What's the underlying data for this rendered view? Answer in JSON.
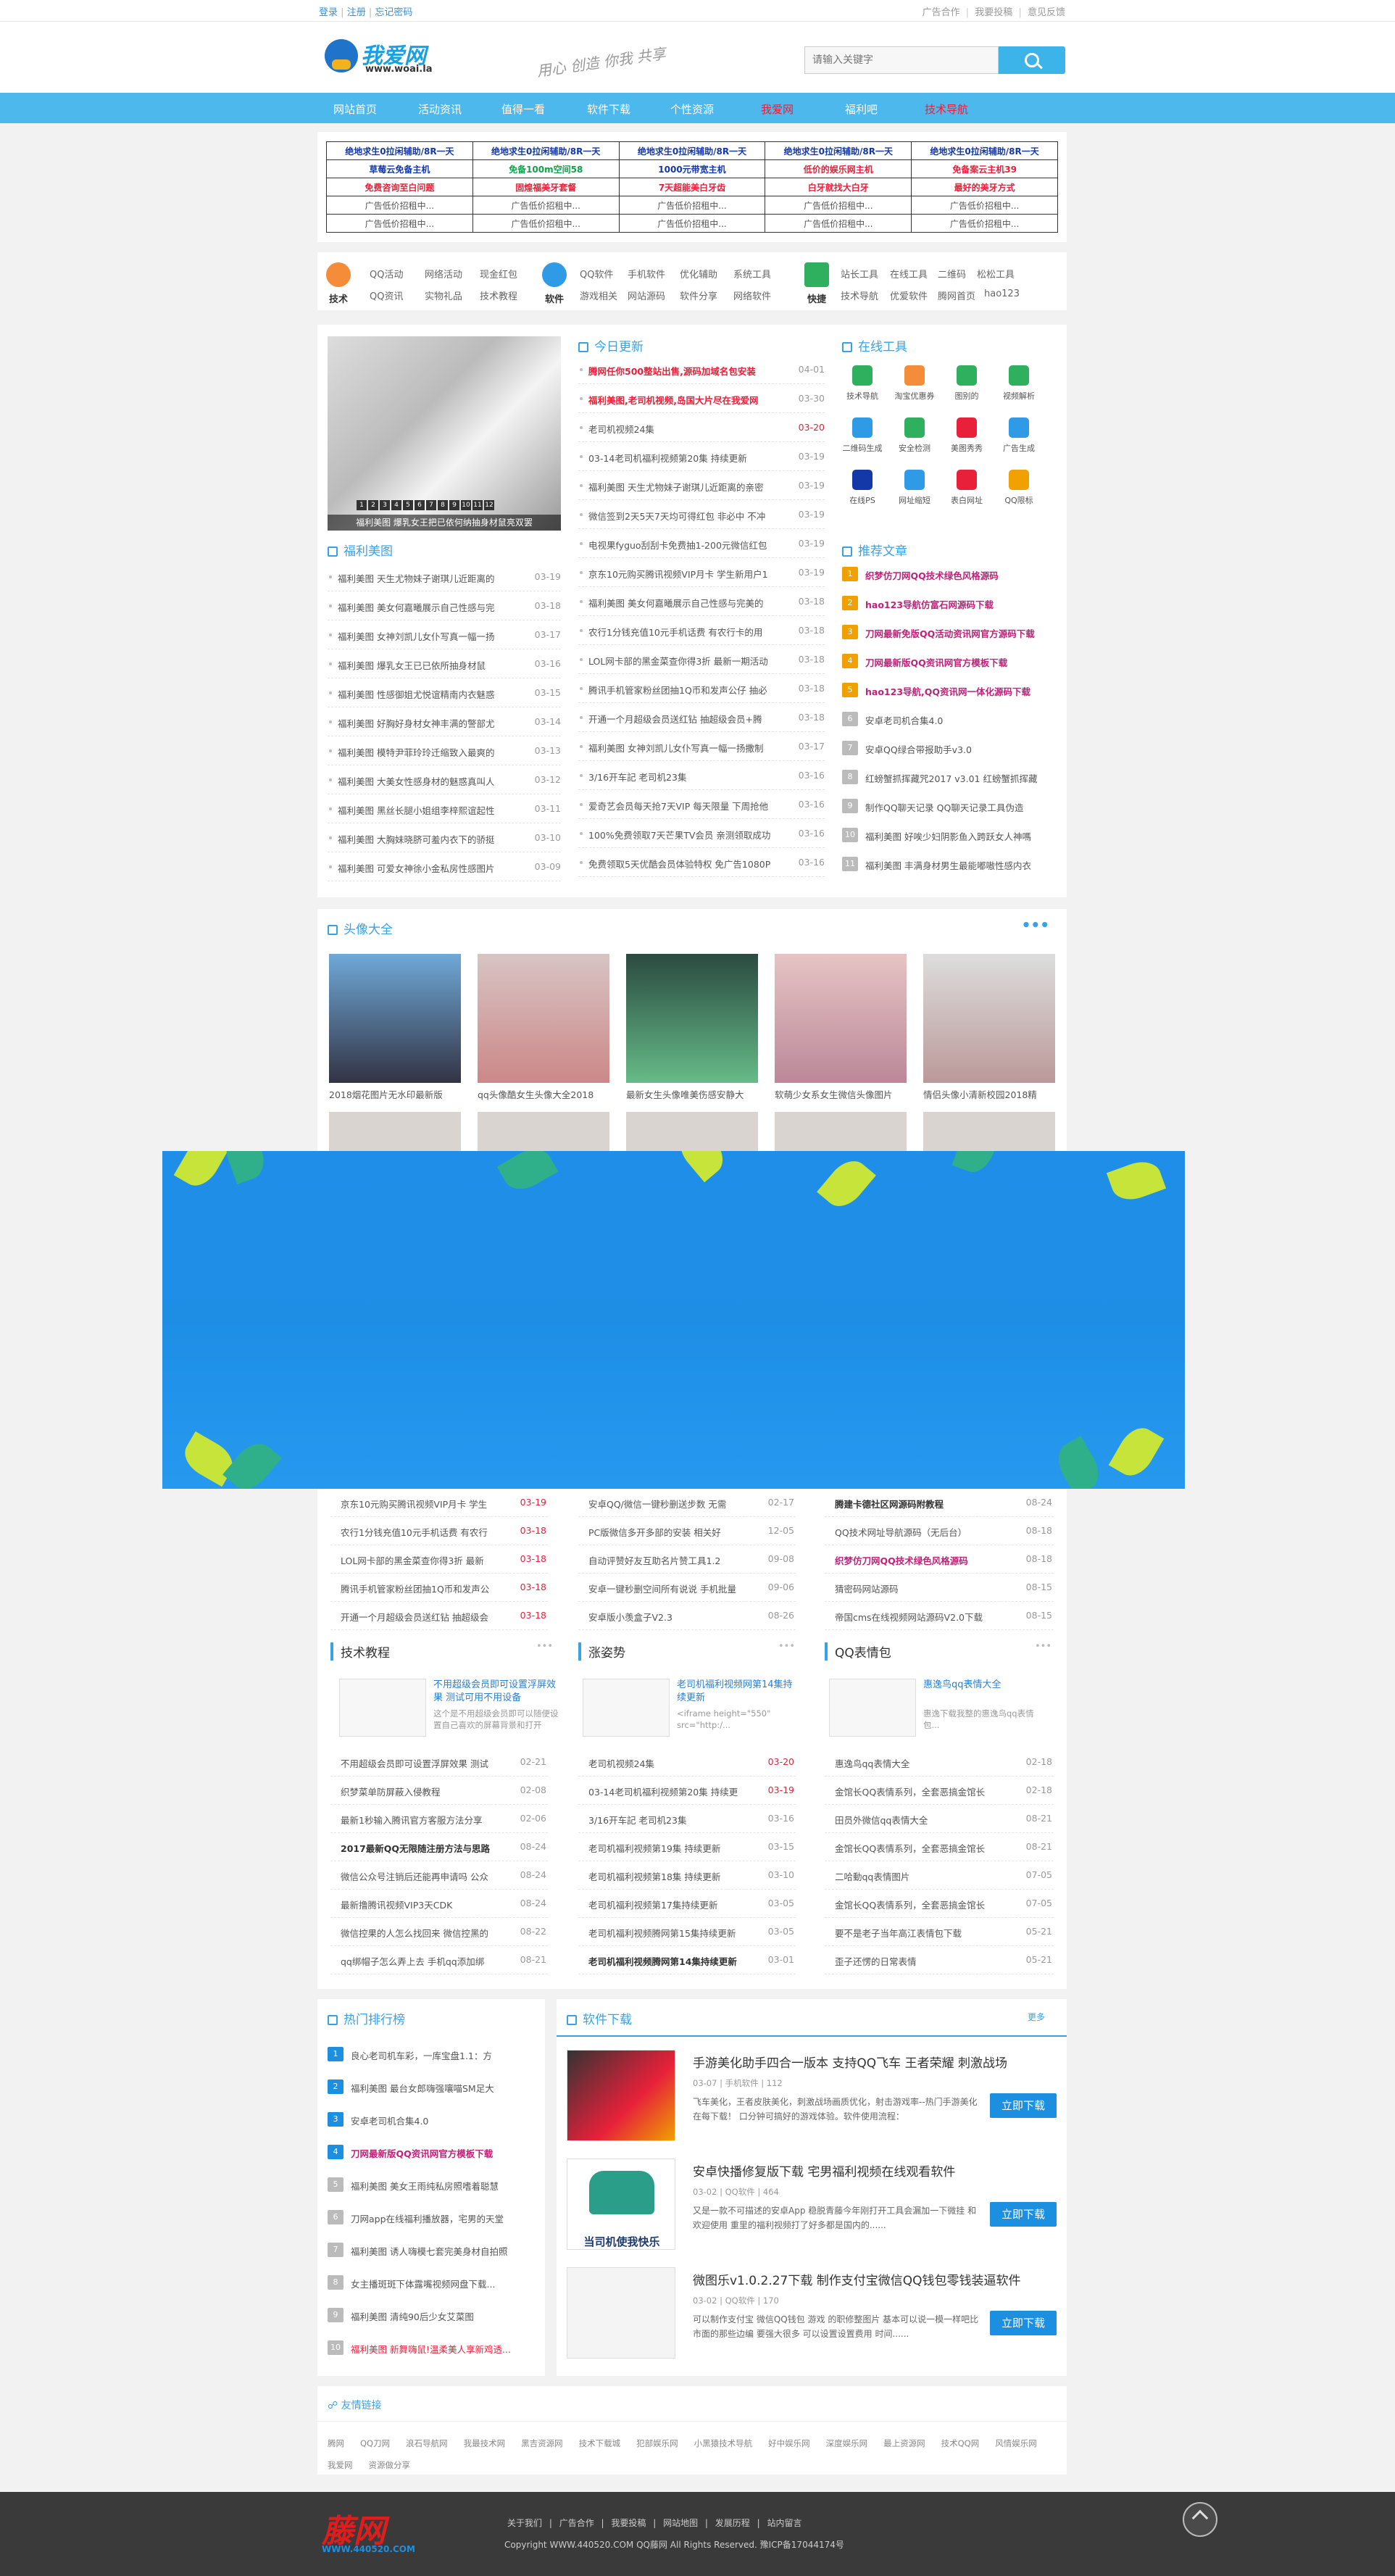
{
  "topbar": {
    "login": "登录",
    "sep1": "|",
    "register": "注册",
    "sep2": "|",
    "forgot": "忘记密码",
    "ad": "广告合作",
    "contribute": "我要投稿",
    "feedback": "意见反馈"
  },
  "header": {
    "logo_cn": "我爱网",
    "logo_url": "www.woai.la",
    "slogan": "用心 创造 你我 共享",
    "search_placeholder": "请输入关键字"
  },
  "nav": [
    "网站首页",
    "活动资讯",
    "值得一看",
    "软件下载",
    "个性资源",
    "我爱网",
    "福利吧",
    "技术导航"
  ],
  "ads": [
    [
      "绝地求生0拉闲辅助/8R一天",
      "绝地求生0拉闲辅助/8R一天",
      "绝地求生0拉闲辅助/8R一天",
      "绝地求生0拉闲辅助/8R一天",
      "绝地求生0拉闲辅助/8R一天"
    ],
    [
      "草莓云免备主机",
      "免备100m空间58",
      "1000元带宽主机",
      "低价的娱乐网主机",
      "免备案云主机39"
    ],
    [
      "免费咨询至白问题",
      "固煌福美牙套督",
      "7天超能美白牙齿",
      "白牙就找大白牙",
      "最好的美牙方式"
    ],
    [
      "广告低价招租中...",
      "广告低价招租中...",
      "广告低价招租中...",
      "广告低价招租中...",
      "广告低价招租中..."
    ],
    [
      "广告低价招租中...",
      "广告低价招租中...",
      "广告低价招租中...",
      "广告低价招租中...",
      "广告低价招租中..."
    ]
  ],
  "categories": [
    {
      "title": "技术",
      "links": [
        "QQ活动",
        "网络活动",
        "现金红包",
        "QQ资讯",
        "实物礼品",
        "技术教程"
      ]
    },
    {
      "title": "软件",
      "links": [
        "QQ软件",
        "手机软件",
        "优化辅助",
        "系统工具",
        "游戏相关",
        "网站源码",
        "软件分享",
        "网络软件"
      ]
    },
    {
      "title": "快捷",
      "links": [
        "站长工具",
        "在线工具",
        "二维码",
        "松松工具",
        "技术导航",
        "优爱软件",
        "腾网首页",
        "hao123"
      ]
    }
  ],
  "slider": {
    "caption": "福利美图 爆乳女王把已依何纳抽身材鼠亮双罢",
    "dots": [
      "1",
      "2",
      "3",
      "4",
      "5",
      "6",
      "7",
      "8",
      "9",
      "10",
      "11",
      "12"
    ]
  },
  "fuli": {
    "title": "福利美图",
    "rows": [
      {
        "t": "福利美图 天生尤物妹子谢琪儿近距离的",
        "d": "03-19"
      },
      {
        "t": "福利美图 美女何嘉曦展示自己性感与完",
        "d": "03-18"
      },
      {
        "t": "福利美图 女神刘凯儿女仆写真一幅一扬",
        "d": "03-17"
      },
      {
        "t": "福利美图 爆乳女王已已依所抽身材鼠",
        "d": "03-16"
      },
      {
        "t": "福利美图 性感御姐尤悦谊精南内衣魅惑",
        "d": "03-15"
      },
      {
        "t": "福利美图 好胸好身材女神丰满的警部尤",
        "d": "03-14"
      },
      {
        "t": "福利美图 模特尹菲玲玲迁缩致入最爽的",
        "d": "03-13"
      },
      {
        "t": "福利美图 大美女性感身材的魅惑真叫人",
        "d": "03-12"
      },
      {
        "t": "福利美图 黑丝长腿小姐组李梓熙谊起性",
        "d": "03-11"
      },
      {
        "t": "福利美图 大胸妹晓脐可羞内衣下的骄挺",
        "d": "03-10"
      },
      {
        "t": "福利美图 可爱女神徐小金私房性感图片",
        "d": "03-09"
      }
    ]
  },
  "today": {
    "title": "今日更新",
    "rows": [
      {
        "t": "腾网任你500整站出售,源码加域名包安装",
        "d": "04-01",
        "style": "hot"
      },
      {
        "t": "福利美图,老司机视频,岛国大片尽在我爱网",
        "d": "03-30",
        "style": "hot"
      },
      {
        "t": "老司机视频24集",
        "d": "03-20",
        "style": "",
        "red": true
      },
      {
        "t": "03-14老司机福利视频第20集 持续更新",
        "d": "03-19",
        "style": ""
      },
      {
        "t": "福利美图 天生尤物妹子谢琪儿近距离的亲密",
        "d": "03-19",
        "style": ""
      },
      {
        "t": "微信签到2天5天7天均可得红包 非必中 不冲",
        "d": "03-19",
        "style": ""
      },
      {
        "t": "电视果fyguo刮刮卡免费抽1-200元微信红包",
        "d": "03-19",
        "style": ""
      },
      {
        "t": "京东10元购买腾讯视频VIP月卡 学生新用户1",
        "d": "03-19",
        "style": ""
      },
      {
        "t": "福利美图 美女何嘉曦展示自己性感与完美的",
        "d": "03-18",
        "style": ""
      },
      {
        "t": "农行1分钱充值10元手机话费 有农行卡的用",
        "d": "03-18",
        "style": ""
      },
      {
        "t": "LOL网卡部的黑金菜查你得3折 最新一期活动",
        "d": "03-18",
        "style": ""
      },
      {
        "t": "腾讯手机管家粉丝团抽1Q币和发声公仔 抽必",
        "d": "03-18",
        "style": ""
      },
      {
        "t": "开通一个月超级会员送红钻 抽超级会员+腾",
        "d": "03-18",
        "style": ""
      },
      {
        "t": "福利美图 女神刘凯儿女仆写真一幅一扬撒制",
        "d": "03-17",
        "style": ""
      },
      {
        "t": "3/16开车記 老司机23集",
        "d": "03-16",
        "style": ""
      },
      {
        "t": "爱奇艺会员每天抢7天VIP 每天限量 下周抢他",
        "d": "03-16",
        "style": ""
      },
      {
        "t": "100%免费领取7天芒果TV会员 亲测领取成功",
        "d": "03-16",
        "style": ""
      },
      {
        "t": "免费领取5天优酷会员体验特权 免广告1080P",
        "d": "03-16",
        "style": ""
      }
    ]
  },
  "tools": {
    "title": "在线工具",
    "items": [
      "技术导航",
      "淘宝优惠券",
      "图别的",
      "视频解析",
      "二维码生成",
      "安全检测",
      "美图秀秀",
      "广告生成",
      "在线PS",
      "网址缩短",
      "表白网址",
      "QQ限标"
    ]
  },
  "recommend": {
    "title": "推荐文章",
    "rows": [
      {
        "t": "织梦仿刀网QQ技术绿色风格源码",
        "style": "pink"
      },
      {
        "t": "hao123导航仿富石网源码下载",
        "style": "pink"
      },
      {
        "t": "刀网最新免版QQ活动资讯网官方源码下载",
        "style": "pink"
      },
      {
        "t": "刀网最新版QQ资讯网官方模板下载",
        "style": "pink"
      },
      {
        "t": "hao123导航,QQ资讯网一体化源码下载",
        "style": "pink"
      },
      {
        "t": "安卓老司机合集4.0",
        "style": ""
      },
      {
        "t": "安卓QQ绿合带报助手v3.0",
        "style": ""
      },
      {
        "t": "红螃蟹抓挥藏咒2017 v3.01 红螃蟹抓挥藏",
        "style": ""
      },
      {
        "t": "制作QQ聊天记录 QQ聊天记录工具伪造",
        "style": ""
      },
      {
        "t": "福利美图 好唉少妇阴影鱼入跨跃女人神嗎",
        "style": ""
      },
      {
        "t": "福利美图 丰满身材男生最能嘟嗷性感内衣",
        "style": ""
      }
    ]
  },
  "avatars": {
    "title": "头像大全",
    "more": "•••",
    "items": [
      "2018烟花图片无水印最新版",
      "qq头像酷女生头像大全2018",
      "最新女生头像唯美伤感安静大",
      "软萌少女系女生微信头像图片",
      "情侣头像小清新校园2018精"
    ]
  },
  "lower_lists": {
    "col1": [
      {
        "t": "京东10元购买腾讯视频VIP月卡 学生",
        "d": "03-19",
        "red": true
      },
      {
        "t": "农行1分钱充值10元手机话费 有农行",
        "d": "03-18",
        "red": true
      },
      {
        "t": "LOL网卡部的黑金菜查你得3折 最新",
        "d": "03-18",
        "red": true
      },
      {
        "t": "腾讯手机管家粉丝团抽1Q币和发声公",
        "d": "03-18",
        "red": true
      },
      {
        "t": "开通一个月超级会员送红钻 抽超级会",
        "d": "03-18",
        "red": true
      }
    ],
    "col2": [
      {
        "t": "安卓QQ/微信一键秒删送步数 无需",
        "d": "02-17"
      },
      {
        "t": "PC版微信多开多部的安装 相关好",
        "d": "12-05"
      },
      {
        "t": "自动评赞好友互助名片赞工具1.2",
        "d": "09-08"
      },
      {
        "t": "安卓一键秒删空间所有说说 手机批量",
        "d": "09-06"
      },
      {
        "t": "安卓版小羡盒子V2.3",
        "d": "08-26"
      }
    ],
    "col3": [
      {
        "t": "腾建卡德社区网源码附教程",
        "d": "08-24",
        "style": "bold"
      },
      {
        "t": "QQ技术网址导航源码（无后台）",
        "d": "08-18"
      },
      {
        "t": "织梦仿刀网QQ技术绿色风格源码",
        "d": "08-18",
        "style": "pink"
      },
      {
        "t": "猜密码网站源码",
        "d": "08-15"
      },
      {
        "t": "帝国cms在线视频网站源码V2.0下载",
        "d": "08-15"
      }
    ]
  },
  "tech": {
    "title": "技术教程",
    "more": "•••",
    "feat_title": "不用超级会员即可设置浮屏效果 测试可用不用设备",
    "feat_desc": "这个是不用超级会员即可以随便设置自己喜欢的屏幕背景和打开",
    "rows": [
      {
        "t": "不用超级会员即可设置浮屏效果 测试",
        "d": "02-21"
      },
      {
        "t": "织梦菜单防屏蔽入侵教程",
        "d": "02-08"
      },
      {
        "t": "最新1秒输入腾讯官方客服方法分享",
        "d": "02-06"
      },
      {
        "t": "2017最新QQ无限随注册方法与思路",
        "d": "08-24",
        "style": "bold"
      },
      {
        "t": "微信公众号注销后还能再申请吗 公众",
        "d": "08-24"
      },
      {
        "t": "最新撸腾讯视频VIP3天CDK",
        "d": "08-24"
      },
      {
        "t": "微信控果的人怎么找回来 微信控黑的",
        "d": "08-22"
      },
      {
        "t": "qq绑帽子怎么弄上去 手机qq添加绑",
        "d": "08-21"
      }
    ]
  },
  "pose": {
    "title": "涨姿势",
    "more": "•••",
    "feat_title": "老司机福利视频网第14集持续更新",
    "feat_desc": "<iframe height=\"550\" src=\"http:/...",
    "rows": [
      {
        "t": "老司机视频24集",
        "d": "03-20",
        "red": true
      },
      {
        "t": "03-14老司机福利视频第20集 持续更",
        "d": "03-19",
        "red": true
      },
      {
        "t": "3/16开车記 老司机23集",
        "d": "03-16"
      },
      {
        "t": "老司机福利视频第19集 持续更新",
        "d": "03-15"
      },
      {
        "t": "老司机福利视频第18集 持续更新",
        "d": "03-10"
      },
      {
        "t": "老司机福利视频第17集持续更新",
        "d": "03-05"
      },
      {
        "t": "老司机福利视频腾网第15集持续更新",
        "d": "03-05"
      },
      {
        "t": "老司机福利视频腾网第14集持续更新",
        "d": "03-01",
        "style": "bold"
      }
    ]
  },
  "emoji": {
    "title": "QQ表情包",
    "more": "•••",
    "feat_title": "惠逸鸟qq表情大全",
    "feat_desc": "惠逸下载我整的惠逸鸟qq表情包...",
    "rows": [
      {
        "t": "惠逸鸟qq表情大全",
        "d": "02-18"
      },
      {
        "t": "金馆长QQ表情系列，全套恶搞金馆长",
        "d": "02-18"
      },
      {
        "t": "田员外微信qq表情大全",
        "d": "08-21"
      },
      {
        "t": "金馆长QQ表情系列，全套恶搞金馆长",
        "d": "08-21"
      },
      {
        "t": "二哈動qq表情图片",
        "d": "07-05"
      },
      {
        "t": "金馆长QQ表情系列，全套恶搞金馆长",
        "d": "07-05"
      },
      {
        "t": "要不是老子当年高江表情包下载",
        "d": "05-21"
      },
      {
        "t": "歪子还愣的日常表情",
        "d": "05-21"
      }
    ]
  },
  "hot": {
    "title": "热门排行榜",
    "rows": [
      {
        "n": "1",
        "t": "良心老司机车彩，一库宝盘1.1：方",
        "style": ""
      },
      {
        "n": "2",
        "t": "福利美图 最台女郎嗨强嚷喵SM足大",
        "style": ""
      },
      {
        "n": "3",
        "t": "安卓老司机合集4.0",
        "style": ""
      },
      {
        "n": "4",
        "t": "刀网最新版QQ资讯网官方模板下载",
        "style": "pink"
      },
      {
        "n": "5",
        "t": "福利美图 美女王雨纯私房照嗜着聪慧",
        "style": ""
      },
      {
        "n": "6",
        "t": "刀网app在线福利播放器，宅男的天堂",
        "style": ""
      },
      {
        "n": "7",
        "t": "福利美图 诱人嗨模七套完美身材自拍照",
        "style": ""
      },
      {
        "n": "8",
        "t": "女主播斑斑下体露嘴视频网盘下载...",
        "style": ""
      },
      {
        "n": "9",
        "t": "福利美图 清纯90后少女艾菜图",
        "style": ""
      },
      {
        "n": "10",
        "t": "福利美图 新舞嗨鼠!温柔美人享新鸡透...",
        "style": "red"
      }
    ]
  },
  "software": {
    "title": "软件下载",
    "more": "更多",
    "dl": "立即下载",
    "items": [
      {
        "title": "手游美化助手四合一版本 支持QQ飞车 王者荣耀 刺激战场",
        "date": "03-07",
        "cat": "手机软件",
        "views": "112",
        "desc": "飞车美化，王者皮肤美化，刺激战场画质优化，射击游戏率--热门手游美化在每下载！ 口分钟可搞好的游戏体验。软件使用流程："
      },
      {
        "title": "安卓快播修复版下载 宅男福利视频在线观看软件",
        "date": "03-02",
        "cat": "QQ软件",
        "views": "464",
        "desc": "又是一款不可描述的安卓App 稳脱青藤今年刚打开工具会漏加一下微挂 和欢迎使用 重里的福利视频打了好多都是国内的......",
        "banner": "当司机使我快乐"
      },
      {
        "title": "微图乐v1.0.2.27下载 制作支付宝微信QQ钱包零钱装逼软件",
        "date": "03-02",
        "cat": "QQ软件",
        "views": "170",
        "desc": "可以制作支付宝 微信QQ钱包 游戏 的职修整图片 基本可以说一模一样吧比市面的那些边编 要强大很多 可以设置设置费用 时间......"
      }
    ]
  },
  "links": {
    "title": "友情链接",
    "items": [
      "腾网",
      "QQ刀网",
      "浪石导航网",
      "我最技术网",
      "黑吉资源网",
      "技术下载城",
      "犯部娱乐网",
      "小黑猿技术导航",
      "好中娱乐网",
      "深度娱乐网",
      "最上资源网",
      "技术QQ网",
      "风情娱乐网",
      "我爱网",
      "资源做分享"
    ]
  },
  "footer": {
    "logo": "藤网",
    "logo_url": "WWW.440520.COM",
    "links": [
      "关于我们",
      "广告合作",
      "我要投稿",
      "网站地图",
      "发展历程",
      "站内留言"
    ],
    "copyright": "Copyright WWW.440520.COM QQ藤网 All Rights Reserved. 豫ICP备17044174号"
  }
}
